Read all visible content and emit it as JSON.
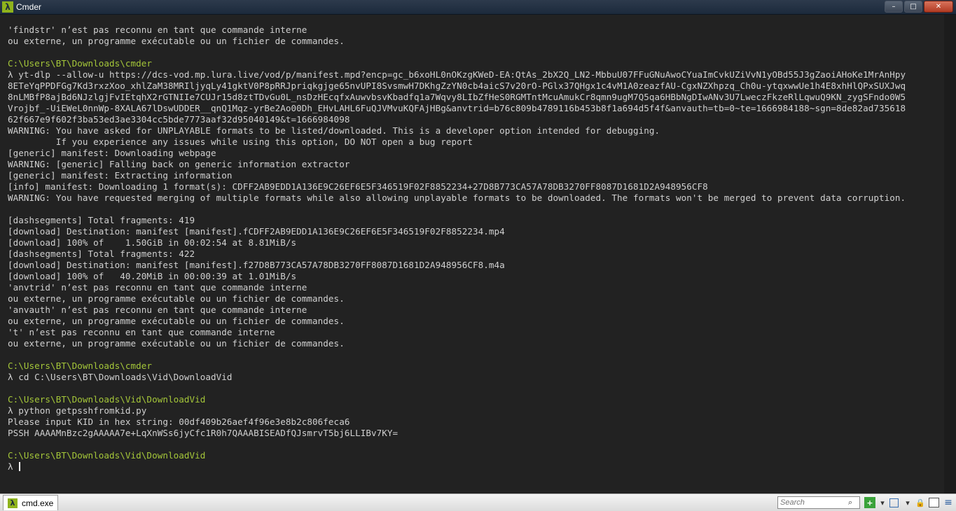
{
  "window": {
    "title": "Cmder",
    "app_icon": "λ"
  },
  "controls": {
    "minimize": "–",
    "maximize": "□",
    "close": "✕"
  },
  "console_lines": [
    {
      "text": "'findstr' n’est pas reconnu en tant que commande interne",
      "type": "out"
    },
    {
      "text": "ou externe, un programme exécutable ou un fichier de commandes.",
      "type": "out"
    },
    {
      "text": "",
      "type": "out"
    },
    {
      "text": "C:\\Users\\BT\\Downloads\\cmder",
      "type": "path"
    },
    {
      "text": "λ yt-dlp --allow-u https://dcs-vod.mp.lura.live/vod/p/manifest.mpd?encp=gc_b6xoHL0nOKzgKWeD-EA:QtAs_2bX2Q_LN2-MbbuU07FFuGNuAwoCYuaImCvkUZiVvN1yOBd55J3gZaoiAHoKe1MrAnHpy",
      "type": "out"
    },
    {
      "text": "8ETeYqPPDFGg7Kd3rxzXoo_xhlZaM38MRIljyqLy41gktV0P8pRRJpriqkgjge65nvUPI8SvsmwH7DKhgZzYN0cb4aicS7v20rO-PGlx37QHgx1c4vM1A0zeazfAU-CgxNZXhpzq_Ch0u-ytqxwwUe1h4E8xhHlQPxSUXJwq",
      "type": "out"
    },
    {
      "text": "8nLMBfP8ajBd6NJzlgjFvIEtqhX2rGTNIIe7CUJr15d8ztTDvGu0L_nsDzHEcqfxAuwvbsvKbadfq1a7Wqvy8LIbZfHeS0RGMTntMcuAmukCr8qmn9ugM7Q5qa6HBbNgDIwANv3U7LweczFkzeRlLqwuQ9KN_zygSFndo0W5",
      "type": "out"
    },
    {
      "text": "Vrojbf_-UiEWeL0nnWp-8XALA67lDswUDDER__qnQ1Mqz-yrBe2Ao00Dh_EHvLAHL6FuQJVMvuKQFAjHBg&anvtrid=b76c809b4789116b453b8f1a694d5f4f&anvauth=tb=0~te=1666984188~sgn=8de82ad735618",
      "type": "out"
    },
    {
      "text": "62f667e9f602f3ba53ed3ae3304cc5bde7773aaf32d95040149&t=1666984098",
      "type": "out"
    },
    {
      "text": "WARNING: You have asked for UNPLAYABLE formats to be listed/downloaded. This is a developer option intended for debugging.",
      "type": "out"
    },
    {
      "text": "         If you experience any issues while using this option, DO NOT open a bug report",
      "type": "out"
    },
    {
      "text": "[generic] manifest: Downloading webpage",
      "type": "out"
    },
    {
      "text": "WARNING: [generic] Falling back on generic information extractor",
      "type": "out"
    },
    {
      "text": "[generic] manifest: Extracting information",
      "type": "out"
    },
    {
      "text": "[info] manifest: Downloading 1 format(s): CDFF2AB9EDD1A136E9C26EF6E5F346519F02F8852234+27D8B773CA57A78DB3270FF8087D1681D2A948956CF8",
      "type": "out"
    },
    {
      "text": "WARNING: You have requested merging of multiple formats while also allowing unplayable formats to be downloaded. The formats won't be merged to prevent data corruption.",
      "type": "out"
    },
    {
      "text": "",
      "type": "out"
    },
    {
      "text": "[dashsegments] Total fragments: 419",
      "type": "out"
    },
    {
      "text": "[download] Destination: manifest [manifest].fCDFF2AB9EDD1A136E9C26EF6E5F346519F02F8852234.mp4",
      "type": "out"
    },
    {
      "text": "[download] 100% of    1.50GiB in 00:02:54 at 8.81MiB/s",
      "type": "out"
    },
    {
      "text": "[dashsegments] Total fragments: 422",
      "type": "out"
    },
    {
      "text": "[download] Destination: manifest [manifest].f27D8B773CA57A78DB3270FF8087D1681D2A948956CF8.m4a",
      "type": "out"
    },
    {
      "text": "[download] 100% of   40.20MiB in 00:00:39 at 1.01MiB/s",
      "type": "out"
    },
    {
      "text": "'anvtrid' n’est pas reconnu en tant que commande interne",
      "type": "out"
    },
    {
      "text": "ou externe, un programme exécutable ou un fichier de commandes.",
      "type": "out"
    },
    {
      "text": "'anvauth' n’est pas reconnu en tant que commande interne",
      "type": "out"
    },
    {
      "text": "ou externe, un programme exécutable ou un fichier de commandes.",
      "type": "out"
    },
    {
      "text": "'t' n’est pas reconnu en tant que commande interne",
      "type": "out"
    },
    {
      "text": "ou externe, un programme exécutable ou un fichier de commandes.",
      "type": "out"
    },
    {
      "text": "",
      "type": "out"
    },
    {
      "text": "C:\\Users\\BT\\Downloads\\cmder",
      "type": "path"
    },
    {
      "text": "λ cd C:\\Users\\BT\\Downloads\\Vid\\DownloadVid",
      "type": "out"
    },
    {
      "text": "",
      "type": "out"
    },
    {
      "text": "C:\\Users\\BT\\Downloads\\Vid\\DownloadVid",
      "type": "path"
    },
    {
      "text": "λ python getpsshfromkid.py",
      "type": "out"
    },
    {
      "text": "Please input KID in hex string: 00df409b26aef4f96e3e8b2c806feca6",
      "type": "out"
    },
    {
      "text": "PSSH AAAAMnBzc2gAAAAA7e+LqXnWSs6jyCfc1R0h7QAAABISEADfQJsmrvT5bj6LLIBv7KY=",
      "type": "out"
    },
    {
      "text": "",
      "type": "out"
    },
    {
      "text": "C:\\Users\\BT\\Downloads\\Vid\\DownloadVid",
      "type": "path"
    },
    {
      "text": "λ ",
      "type": "prompt"
    }
  ],
  "bottombar": {
    "tab_label": "cmd.exe",
    "tab_icon": "λ",
    "search_placeholder": "Search",
    "search_icon": "magnifier-icon"
  }
}
